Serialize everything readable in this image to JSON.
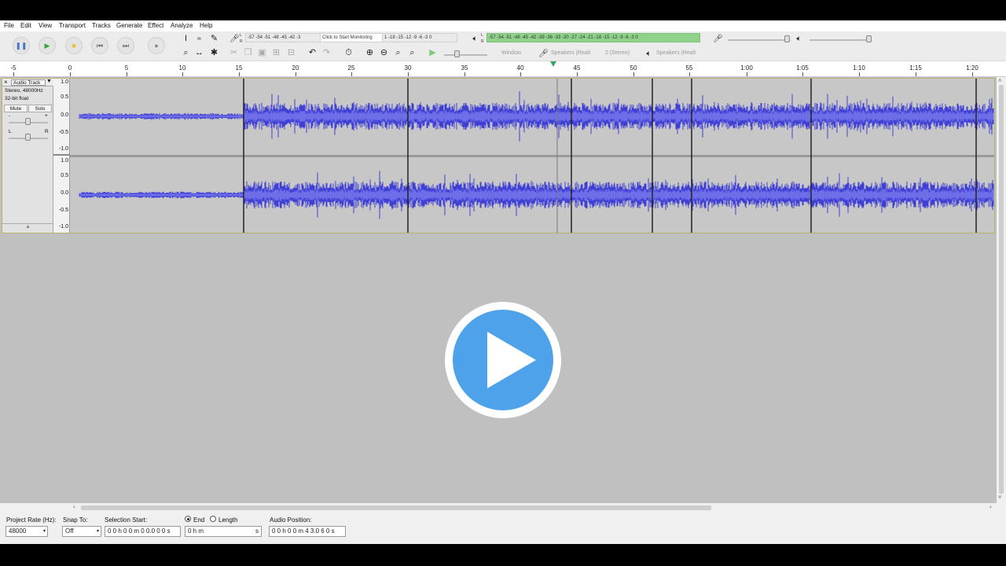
{
  "menu": [
    "File",
    "Edit",
    "View",
    "Transport",
    "Tracks",
    "Generate",
    "Effect",
    "Analyze",
    "Help"
  ],
  "transport": {
    "pause": "pause-icon",
    "play": "play-icon",
    "stop": "stop-icon",
    "skip_start": "skip-start-icon",
    "skip_end": "skip-end-icon",
    "record": "record-icon"
  },
  "meters": {
    "record_scale": "-57 -54 -51 -48 -45 -42 -3",
    "record_prompt": "Click to Start Monitoring",
    "record_scale_end": "1 -18 -15 -12 -9 -6 -3 0",
    "playback_scale": "-57 -54 -51 -48 -45 -42 -39 -36 -33 -30 -27 -24 -21 -18 -15 -12 -9 -6 -3 0",
    "lr_top": "L",
    "lr_bottom": "R"
  },
  "device": {
    "host": "Window",
    "recording_device": "Speakers (Realt",
    "channels": "2 (Stereo)",
    "playback_device": "Speakers (Realt"
  },
  "ruler": {
    "labels": [
      "-5",
      "0",
      "5",
      "10",
      "15",
      "20",
      "25",
      "30",
      "35",
      "40",
      "45",
      "50",
      "55",
      "1:00",
      "1:05",
      "1:10",
      "1:15",
      "1:20"
    ]
  },
  "track": {
    "name": "Audio Track",
    "info1": "Stereo, 48000Hz",
    "info2": "32-bit float",
    "mute": "Mute",
    "solo": "Solo",
    "gain_minus": "-",
    "gain_plus": "+",
    "pan_l": "L",
    "pan_r": "R",
    "scale": [
      "1.0",
      "0.5",
      "0.0",
      "-0.5",
      "-1.0"
    ]
  },
  "selection": {
    "rate_label": "Project Rate (Hz):",
    "rate_value": "48000",
    "snap_label": "Snap To:",
    "snap_value": "Off",
    "start_label": "Selection Start:",
    "start_value": "0 0 h 0 0 m 0 0.0 0 0 s",
    "end_label": "End",
    "length_label": "Length",
    "end_value": "0   h      m",
    "end_unit": "s",
    "pos_label": "Audio Position:",
    "pos_value": "0 0 h 0 0 m 4 3.0 6 0 s"
  },
  "colors": {
    "wave": "#3f3fd6",
    "wave_light": "#6e6ee8",
    "accent": "#4da2ea",
    "meter_green": "#8fd38a"
  }
}
